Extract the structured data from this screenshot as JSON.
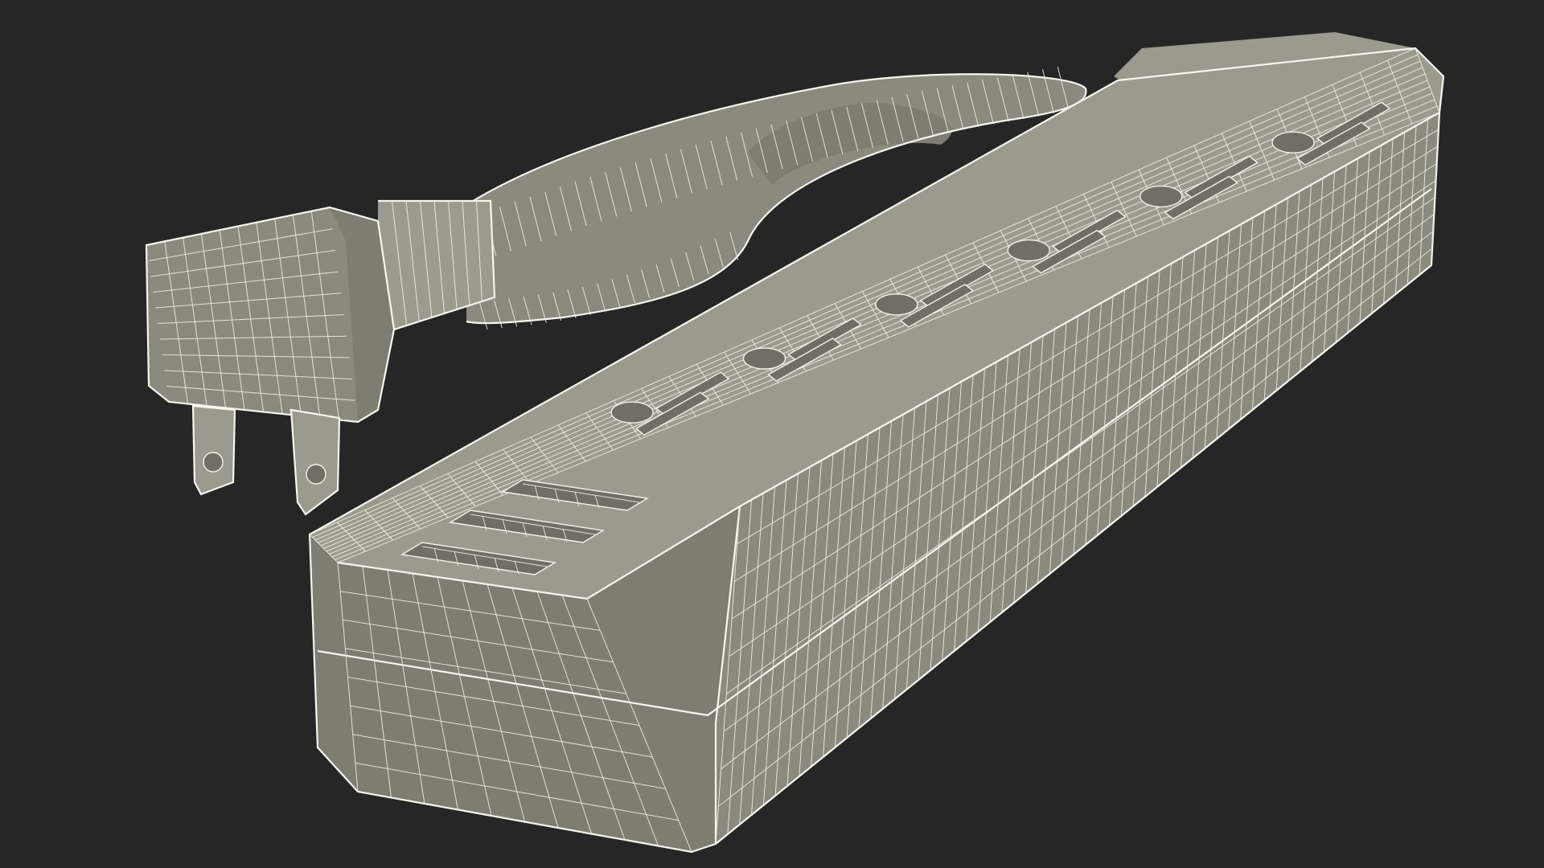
{
  "scene": {
    "background_color": "#262626",
    "model_fill_color": "#8a8a7e",
    "wire_color": "#f2f2e8",
    "subject": "power-strip-wireframe"
  }
}
